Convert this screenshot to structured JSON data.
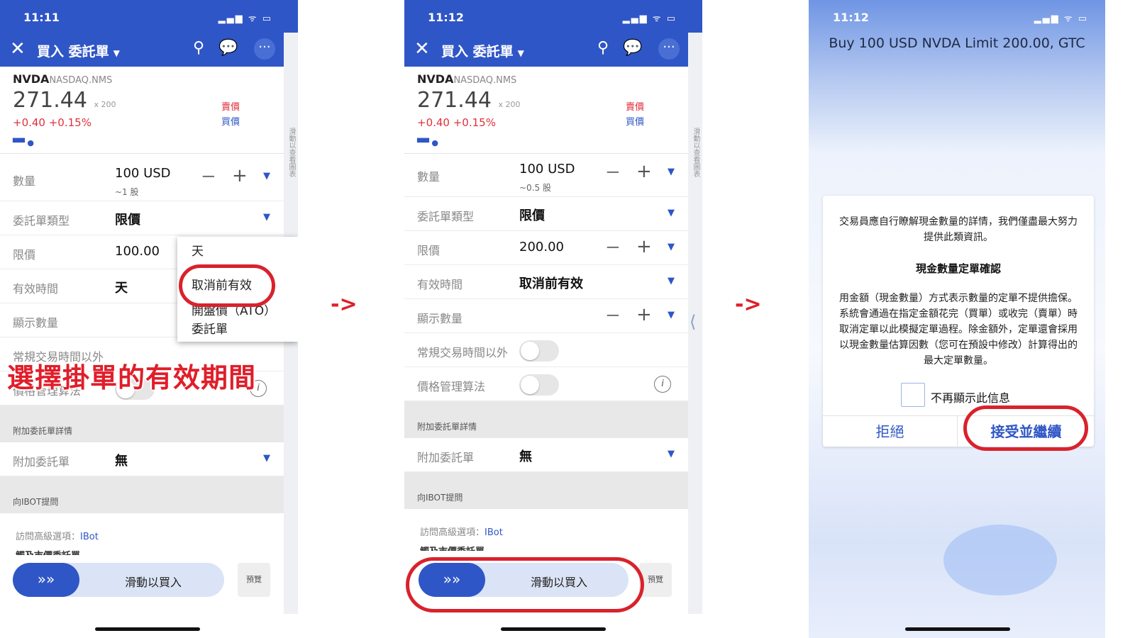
{
  "status_time_1": "11:11",
  "status_time_2": "11:12",
  "status_time_3": "11:12",
  "header_title": "買入 委託單",
  "side_label": "滑動以查看圖表",
  "instrument": {
    "symbol": "NVDA",
    "exchange": "NASDAQ.NMS",
    "price": "271.44",
    "price_size": "x 200",
    "change": "+0.40 +0.15%",
    "ask_label": "賣價",
    "bid_label": "買價"
  },
  "labels": {
    "quantity": "數量",
    "order_type": "委託單類型",
    "limit_price": "限價",
    "time_in_force": "有效時間",
    "display_size": "顯示數量",
    "outside_rth": "常規交易時間以外",
    "price_algo": "價格管理算法",
    "attached_section": "附加委託單詳情",
    "attached_order": "附加委託單",
    "ibot_section": "向IBOT提問",
    "ibot_link_prefix": "訪問高級選項：",
    "ibot_link": "IBot",
    "cut_text": "觸及市價委託單",
    "slide_to_buy": "滑動以買入",
    "preview": "預覽"
  },
  "panel1": {
    "quantity_value": "100 USD",
    "quantity_sub": "~1 股",
    "order_type_value": "限價",
    "limit_value": "100.00",
    "tif_value": "天",
    "attached_value": "無",
    "annotation": "選擇掛單的有效期間",
    "popup_options": [
      "天",
      "取消前有效",
      "開盤價（ATO）",
      "委託單"
    ]
  },
  "panel2": {
    "quantity_value": "100 USD",
    "quantity_sub": "~0.5 股",
    "order_type_value": "限價",
    "limit_value": "200.00",
    "tif_value": "取消前有效",
    "attached_value": "無"
  },
  "panel3": {
    "title": "Buy 100 USD NVDA Limit 200.00, GTC",
    "intro": "交易員應自行瞭解現金數量的詳情，我們僅盡最大努力提供此類資訊。",
    "heading": "現金數量定單確認",
    "body": "用金額（現金數量）方式表示數量的定單不提供擔保。系統會通過在指定金額花完（買單）或收完（賣單）時取消定單以此模擬定單過程。除金額外，定單還會採用以現金數量估算因數（您可在預設中修改）計算得出的最大定單數量。",
    "checkbox_label": "不再顯示此信息",
    "reject": "拒絕",
    "accept": "接受並繼續"
  },
  "arrow": "->",
  "colors": {
    "brand_blue": "#2f56c6",
    "highlight_red": "#d9222c",
    "price_red": "#e0303c"
  }
}
